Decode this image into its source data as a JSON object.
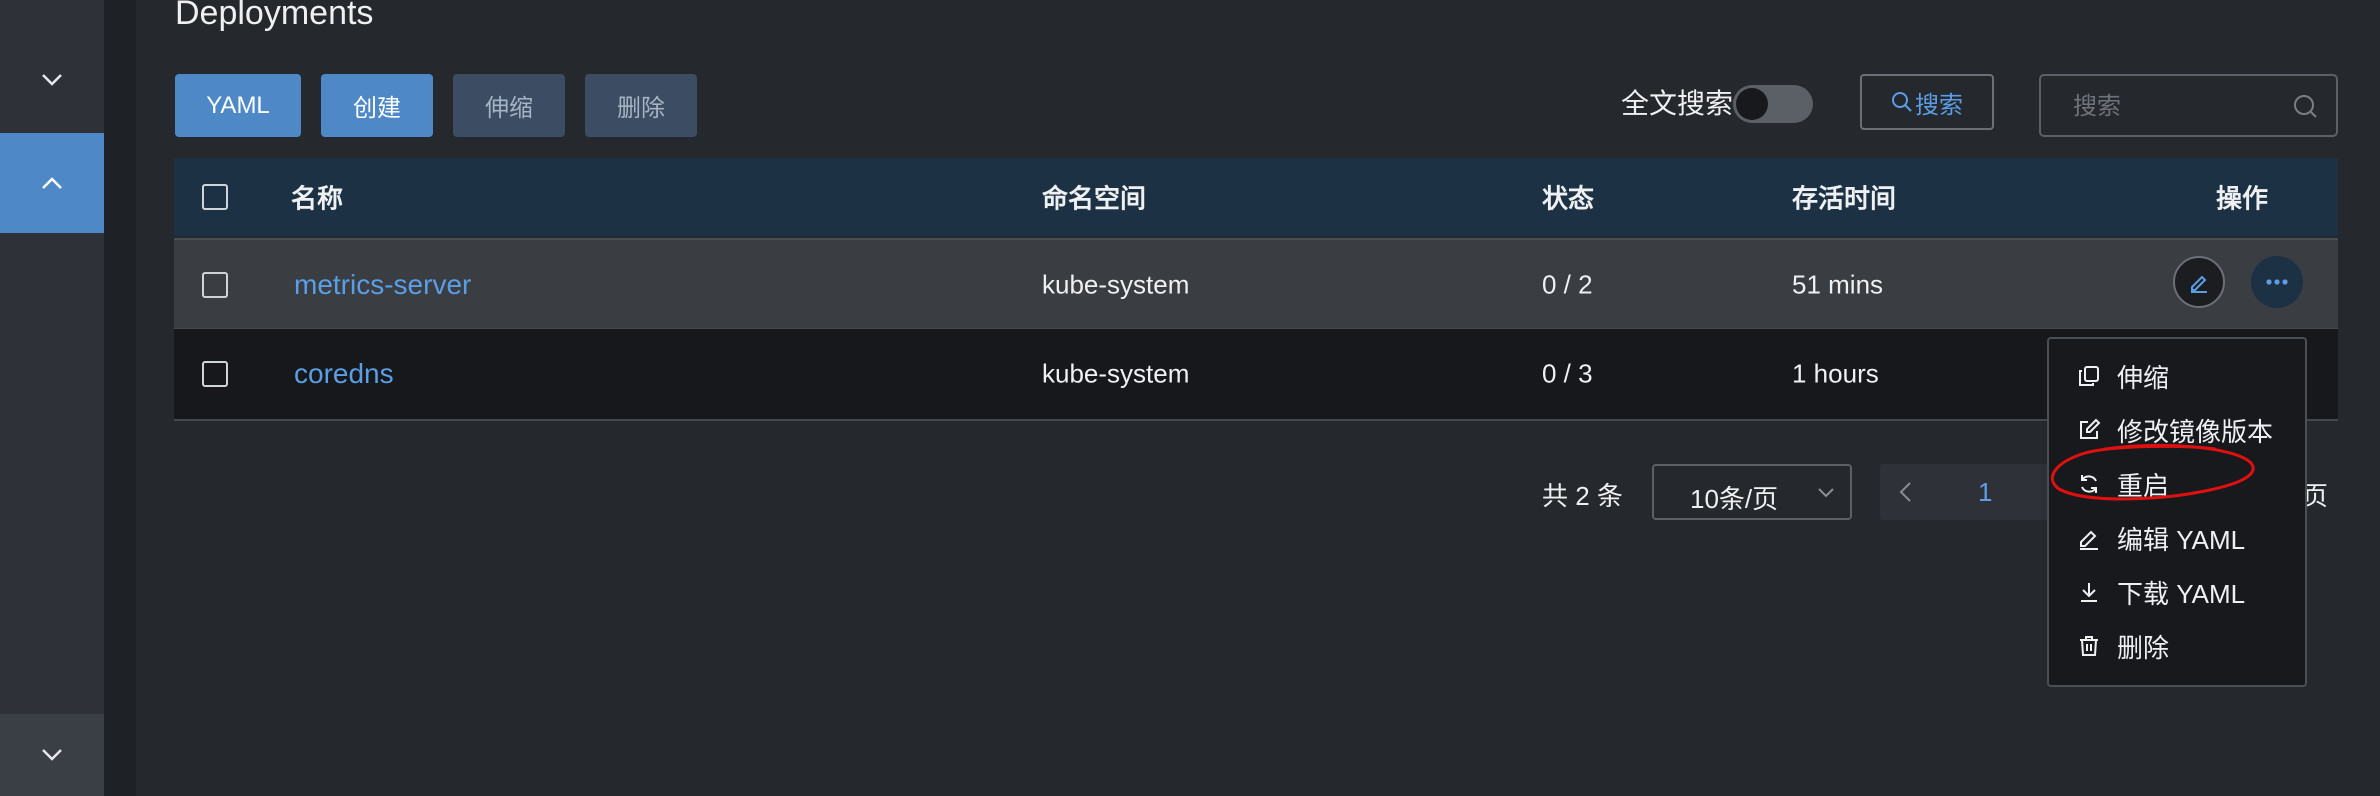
{
  "page": {
    "title": "Deployments"
  },
  "toolbar": {
    "yaml_label": "YAML",
    "create_label": "创建",
    "scale_label": "伸缩",
    "delete_label": "删除",
    "full_text_search_label": "全文搜索",
    "full_text_search_enabled": false,
    "search_button_label": "搜索",
    "search_placeholder": "搜索"
  },
  "table": {
    "headers": {
      "name": "名称",
      "namespace": "命名空间",
      "status": "状态",
      "age": "存活时间",
      "actions": "操作"
    },
    "rows": [
      {
        "name": "metrics-server",
        "namespace": "kube-system",
        "status": "0 / 2",
        "age": "51 mins"
      },
      {
        "name": "coredns",
        "namespace": "kube-system",
        "status": "0 / 3",
        "age": "1 hours"
      }
    ]
  },
  "pagination": {
    "total": "共 2 条",
    "page_size": "10条/页",
    "current_page": "1",
    "suffix": "页"
  },
  "action_menu": {
    "items": [
      {
        "label": "伸缩",
        "icon": "copy-icon"
      },
      {
        "label": "修改镜像版本",
        "icon": "edit-square-icon"
      },
      {
        "label": "重启",
        "icon": "refresh-icon"
      },
      {
        "label": "编辑 YAML",
        "icon": "pencil-icon"
      },
      {
        "label": "下载 YAML",
        "icon": "download-icon"
      },
      {
        "label": "删除",
        "icon": "trash-icon"
      }
    ]
  },
  "colors": {
    "accent": "#4f88c6",
    "link": "#5b9ee6",
    "annotation": "#e01010",
    "background": "#25282d"
  }
}
